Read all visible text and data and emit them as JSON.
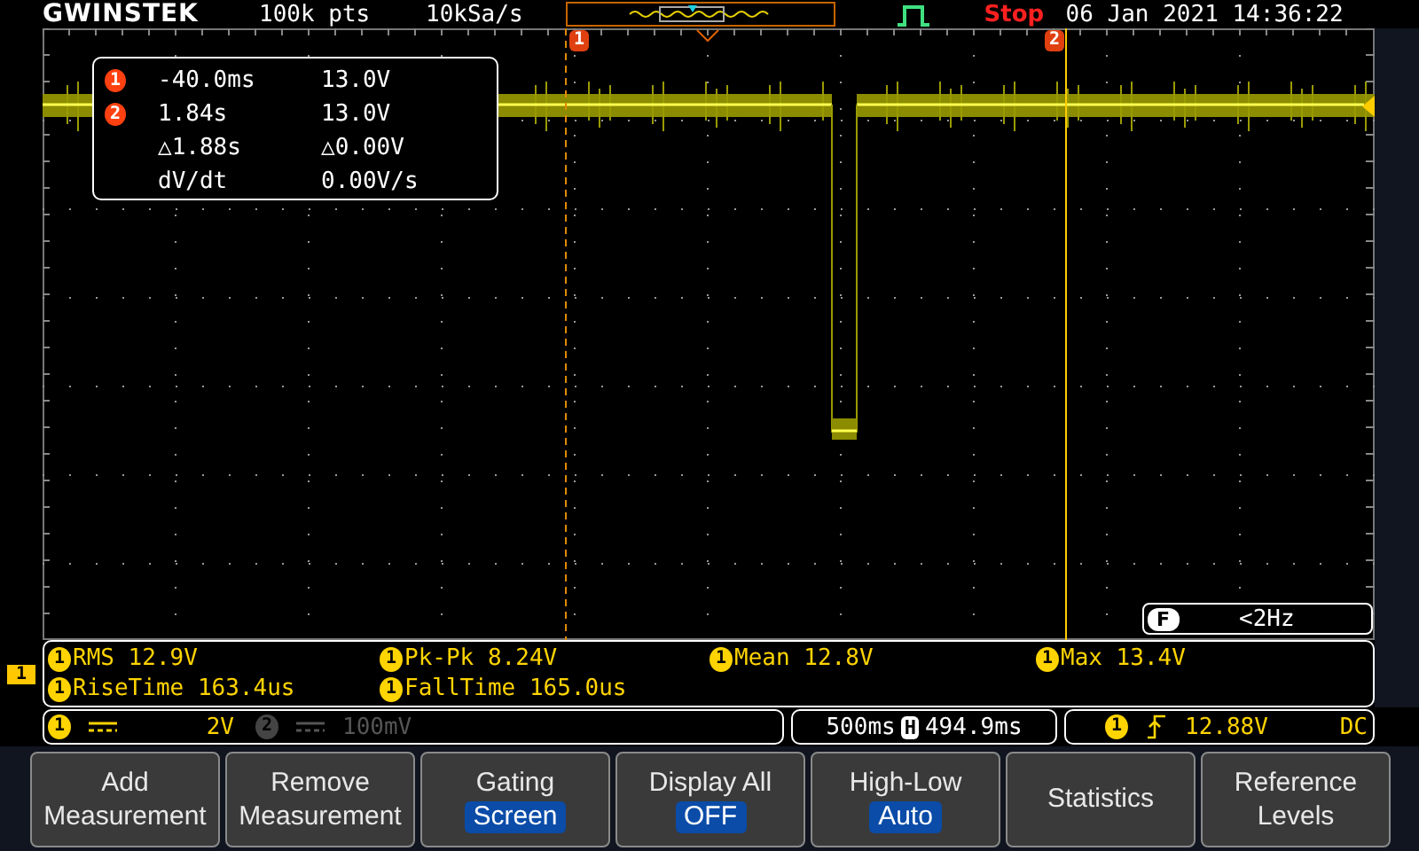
{
  "header": {
    "logo": "GWINSTEK",
    "record_length": "100k pts",
    "sample_rate": "10kSa/s",
    "run_state": "Stop",
    "datetime": "06 Jan 2021 14:36:22"
  },
  "cursor_labels": [
    "1",
    "2"
  ],
  "cursor_readout": [
    {
      "marker": "1",
      "col_1": "-40.0ms",
      "col_2": "13.0V"
    },
    {
      "marker": "2",
      "col_1": "1.84s",
      "col_2": "13.0V"
    },
    {
      "col_1": "△1.88s",
      "col_2": "△0.00V"
    },
    {
      "col_1": "dV/dt",
      "col_2": "0.00V/s"
    }
  ],
  "frequency_counter": {
    "badge": "F",
    "value": "<2Hz"
  },
  "channel_marker": "1",
  "measurements": [
    {
      "channel": "1",
      "text": "RMS 12.9V"
    },
    {
      "channel": "1",
      "text": "Pk-Pk 8.24V"
    },
    {
      "channel": "1",
      "text": "Mean 12.8V"
    },
    {
      "channel": "1",
      "text": "Max 13.4V"
    },
    {
      "channel": "1",
      "text": "RiseTime 163.4us"
    },
    {
      "channel": "1",
      "text": "FallTime 165.0us"
    }
  ],
  "status_bar": {
    "channels": [
      {
        "number": "1",
        "scale": "2V",
        "enabled": true
      },
      {
        "number": "2",
        "scale": "100mV",
        "enabled": false
      }
    ],
    "timebase": {
      "scale": "500ms",
      "position_badge": "H",
      "position": "494.9ms"
    },
    "trigger": {
      "source": "1",
      "level": "12.88V",
      "coupling": "DC"
    }
  },
  "softkeys": [
    {
      "lines": [
        "Add",
        "Measurement"
      ]
    },
    {
      "lines": [
        "Remove",
        "Measurement"
      ]
    },
    {
      "lines": [
        "Gating"
      ],
      "value": "Screen"
    },
    {
      "lines": [
        "Display All"
      ],
      "value": "OFF"
    },
    {
      "lines": [
        "High-Low"
      ],
      "value": "Auto"
    },
    {
      "lines": [
        "Statistics"
      ]
    },
    {
      "lines": [
        "Reference",
        "Levels"
      ]
    }
  ]
}
